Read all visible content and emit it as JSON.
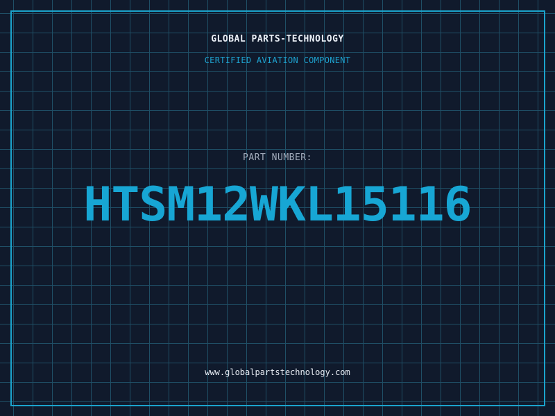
{
  "company": "GLOBAL PARTS-TECHNOLOGY",
  "tagline": "CERTIFIED AVIATION COMPONENT",
  "part_label": "PART NUMBER:",
  "part_number": "HTSM12WKL15116",
  "website": "www.globalpartstechnology.com",
  "colors": {
    "background": "#101a2c",
    "grid": "#1f4f66",
    "accent": "#1ba3cc",
    "text": "#e9eef5",
    "muted": "#a4adbd"
  }
}
